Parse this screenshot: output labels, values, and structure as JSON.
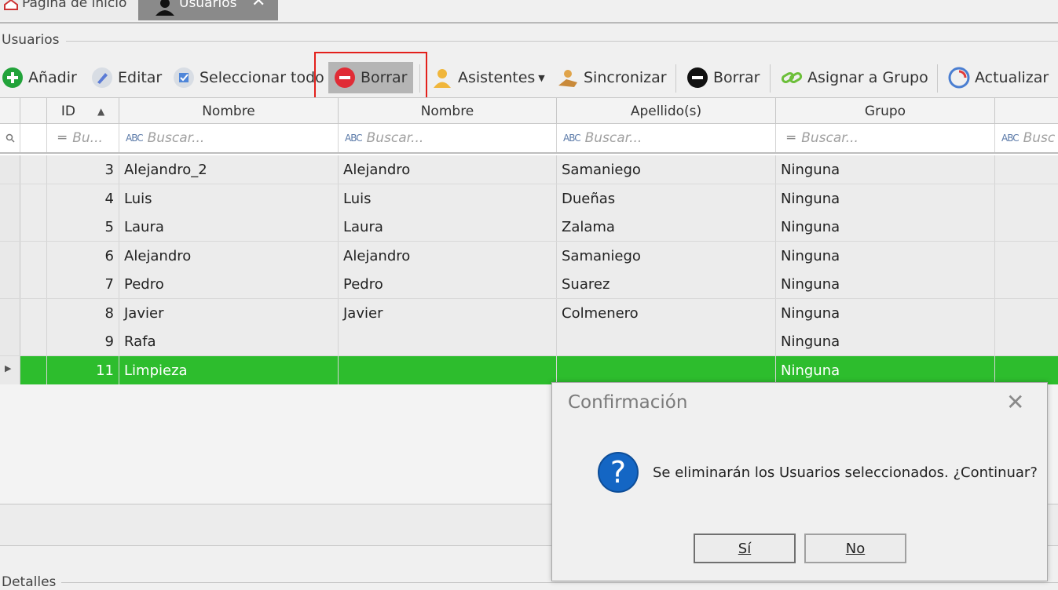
{
  "tabs": [
    {
      "label": "Página de inicio"
    },
    {
      "label": "Usuarios",
      "close": "✕"
    }
  ],
  "group_title": "Usuarios",
  "toolbar": {
    "add": "Añadir",
    "edit": "Editar",
    "select_all": "Seleccionar todo",
    "delete": "Borrar",
    "assistants": "Asistentes",
    "sync": "Sincronizar",
    "delete2": "Borrar",
    "assign_group": "Asignar a Grupo",
    "refresh": "Actualizar"
  },
  "columns": {
    "id": "ID",
    "nombre1": "Nombre",
    "nombre2": "Nombre",
    "apellidos": "Apellido(s)",
    "grupo": "Grupo"
  },
  "filters": {
    "id_placeholder": "Bu...",
    "text_placeholder": "Buscar...",
    "text_placeholder_cut": "Busc"
  },
  "rows": [
    {
      "id": "3",
      "user": "Alejandro_2",
      "nombre": "Alejandro",
      "apellidos": "Samaniego",
      "grupo": "Ninguna"
    },
    {
      "id": "4",
      "user": "Luis",
      "nombre": "Luis",
      "apellidos": "Dueñas",
      "grupo": "Ninguna"
    },
    {
      "id": "5",
      "user": "Laura",
      "nombre": "Laura",
      "apellidos": "Zalama",
      "grupo": "Ninguna"
    },
    {
      "id": "6",
      "user": "Alejandro",
      "nombre": "Alejandro",
      "apellidos": "Samaniego",
      "grupo": "Ninguna"
    },
    {
      "id": "7",
      "user": "Pedro",
      "nombre": "Pedro",
      "apellidos": "Suarez",
      "grupo": "Ninguna"
    },
    {
      "id": "8",
      "user": "Javier",
      "nombre": "Javier",
      "apellidos": "Colmenero",
      "grupo": "Ninguna"
    },
    {
      "id": "9",
      "user": "Rafa",
      "nombre": "",
      "apellidos": "",
      "grupo": "Ninguna"
    },
    {
      "id": "11",
      "user": "Limpieza",
      "nombre": "",
      "apellidos": "",
      "grupo": "Ninguna",
      "selected": true
    }
  ],
  "details_title": "Detalles",
  "dialog": {
    "title": "Confirmación",
    "message": "Se eliminarán los Usuarios seleccionados. ¿Continuar?",
    "yes": "Sí",
    "no": "No"
  },
  "colors": {
    "selected_row": "#2dbd2d",
    "highlight_box": "#e3201b",
    "question_icon": "#1466c4"
  }
}
